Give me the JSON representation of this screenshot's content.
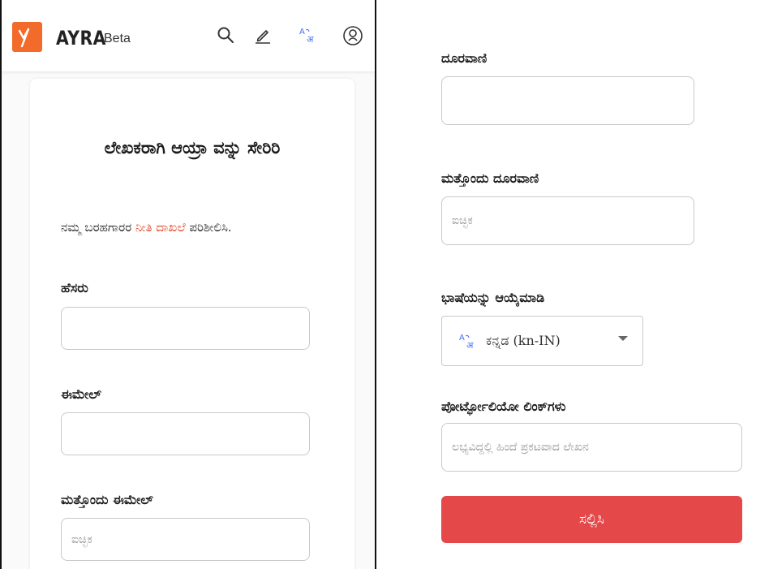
{
  "header": {
    "brand": "AYRA",
    "badge": "Beta",
    "icons": [
      "search-icon",
      "edit-icon",
      "translate-icon",
      "account-icon"
    ]
  },
  "form": {
    "title": "ಲೇಖಕರಾಗಿ ಆಯ್ರಾ ವನ್ನು ಸೇರಿರಿ",
    "policy_prefix": "ನಮ್ಮ ಬರಹಗಾರರ ",
    "policy_link": "ನೀತಿ ದಾಖಲೆ",
    "policy_suffix": " ಪರಿಶೀಲಿಸಿ.",
    "name_label": "ಹೆಸರು",
    "name_value": "",
    "email_label": "ಈಮೇಲ್",
    "email_value": "",
    "alt_email_label": "ಮತ್ತೊಂದು ಈಮೇಲ್",
    "alt_email_placeholder": "ಐಚ್ಛಿಕ",
    "phone_label": "ದೂರವಾಣಿ",
    "phone_value": "",
    "alt_phone_label": "ಮತ್ತೊಂದು ದೂರವಾಣಿ",
    "alt_phone_placeholder": "ಐಚ್ಛಿಕ",
    "language_label": "ಭಾಷೆಯನ್ನು ಆಯ್ಕೆಮಾಡಿ",
    "language_selected": "ಕನ್ನಡ (kn-IN)",
    "portfolio_label": "ಪೋರ್ಟ್ಫೋಲಿಯೋ ಲಿಂಕ್‌ಗಳು",
    "portfolio_placeholder": "ಲಭ್ಯವಿದ್ದಲ್ಲಿ ಹಿಂದೆ ಪ್ರಕಟವಾದ ಲೇಖನ",
    "submit_label": "ಸಲ್ಲಿಸಿ"
  },
  "colors": {
    "brand": "#f26b2a",
    "link": "#e2482a",
    "submit": "#e44848",
    "translate_icon": "#4a6cf7"
  }
}
